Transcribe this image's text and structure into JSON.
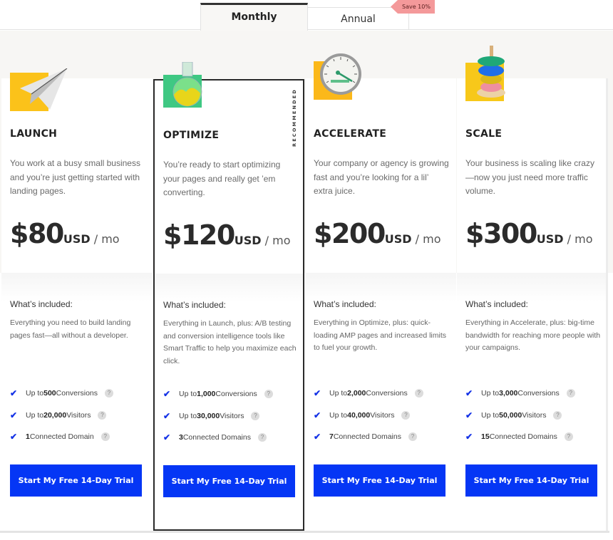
{
  "tabs": {
    "monthly": "Monthly",
    "annual": "Annual",
    "save_badge": "Save 10%"
  },
  "colors": {
    "cta": "#0536f5",
    "check": "#1432e6",
    "badge": "#f4999a"
  },
  "plans": [
    {
      "icon": "paper-plane-icon",
      "name": "LAUNCH",
      "description": "You work at a busy small business and you’re just getting started with landing pages.",
      "price": "$80",
      "currency": "USD",
      "period": " / mo",
      "included_title": "What’s included:",
      "included_desc": "Everything you need to build landing pages fast—all without a developer.",
      "features": [
        {
          "pre": "Up to ",
          "bold": "500",
          "post": " Conversions"
        },
        {
          "pre": "Up to ",
          "bold": "20,000",
          "post": " Visitors"
        },
        {
          "pre": "",
          "bold": "1",
          "post": " Connected Domain"
        }
      ],
      "cta": "Start My Free 14-Day Trial"
    },
    {
      "icon": "flask-icon",
      "name": "OPTIMIZE",
      "badge": "RECOMMENDED",
      "description": "You’re ready to start optimizing your pages and really get ’em converting.",
      "price": "$120",
      "currency": "USD",
      "period": " / mo",
      "included_title": "What’s included:",
      "included_desc": "Everything in Launch, plus: A/B testing and conversion intelligence tools like Smart Traffic to help you maximize each click.",
      "features": [
        {
          "pre": "Up to ",
          "bold": "1,000",
          "post": " Conversions"
        },
        {
          "pre": "Up to ",
          "bold": "30,000",
          "post": " Visitors"
        },
        {
          "pre": "",
          "bold": "3",
          "post": " Connected Domains"
        }
      ],
      "cta": "Start My Free 14-Day Trial"
    },
    {
      "icon": "speedometer-icon",
      "name": "ACCELERATE",
      "description": "Your company or agency is growing fast and you’re looking for a lil’ extra juice.",
      "price": "$200",
      "currency": "USD",
      "period": " / mo",
      "included_title": "What’s included:",
      "included_desc": "Everything in Optimize, plus: quick-loading AMP pages and increased limits to fuel your growth.",
      "features": [
        {
          "pre": "Up to ",
          "bold": "2,000",
          "post": " Conversions"
        },
        {
          "pre": "Up to ",
          "bold": "40,000",
          "post": " Visitors"
        },
        {
          "pre": "",
          "bold": "7",
          "post": " Connected Domains"
        }
      ],
      "cta": "Start My Free 14-Day Trial"
    },
    {
      "icon": "stacking-rings-icon",
      "name": "SCALE",
      "description": "Your business is scaling like crazy—now you just need more traffic volume.",
      "price": "$300",
      "currency": "USD",
      "period": " / mo",
      "included_title": "What’s included:",
      "included_desc": "Everything in Accelerate, plus: big-time bandwidth for reaching more people with your campaigns.",
      "features": [
        {
          "pre": "Up to ",
          "bold": "3,000",
          "post": " Conversions"
        },
        {
          "pre": "Up to ",
          "bold": "50,000",
          "post": " Visitors"
        },
        {
          "pre": "",
          "bold": "15",
          "post": " Connected Domains"
        }
      ],
      "cta": "Start My Free 14-Day Trial"
    }
  ],
  "help_glyph": "?",
  "check_glyph": "✔"
}
